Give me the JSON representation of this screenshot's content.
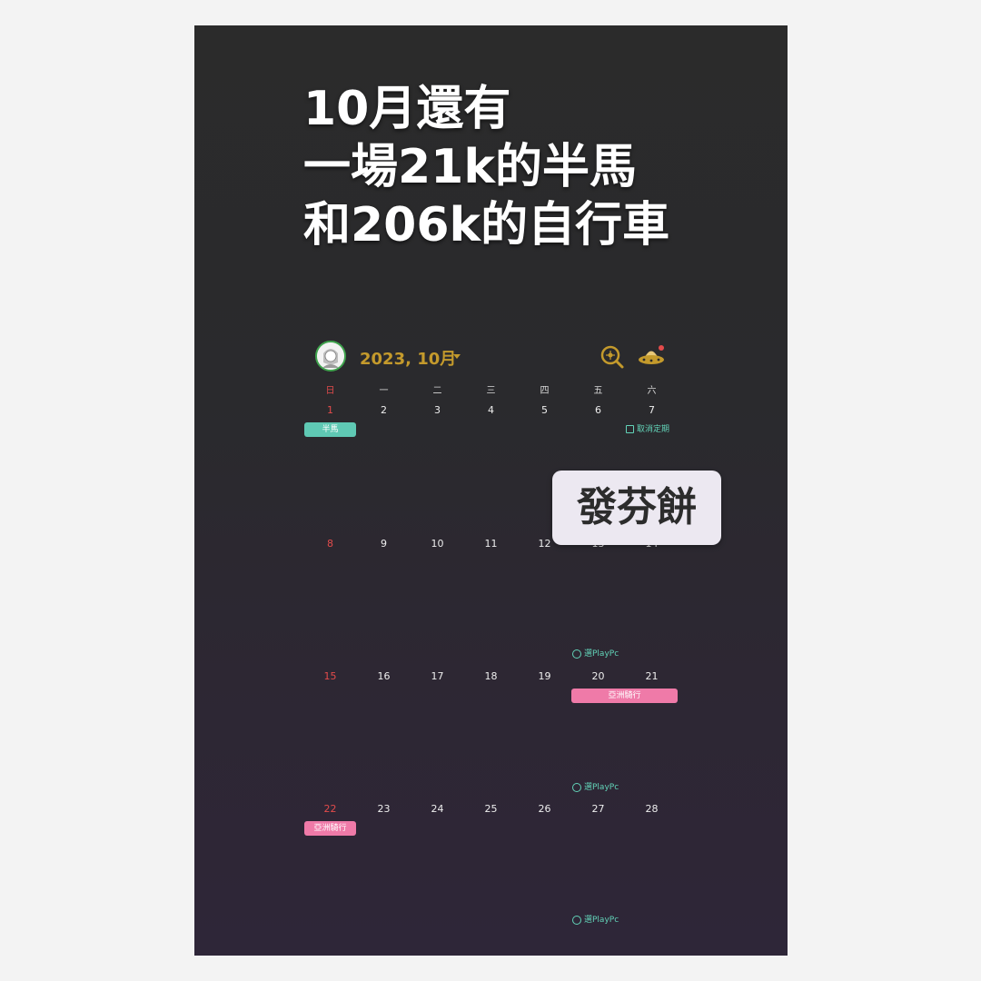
{
  "caption": {
    "lines": [
      "10月還有",
      "一場21k的半馬",
      "和206k的自行車"
    ]
  },
  "calendar": {
    "title": "2023, 10月",
    "accent_color": "#c49a2c",
    "weekdays": [
      "日",
      "一",
      "二",
      "三",
      "四",
      "五",
      "六"
    ],
    "weeks": [
      [
        "1",
        "2",
        "3",
        "4",
        "5",
        "6",
        "7"
      ],
      [
        "8",
        "9",
        "10",
        "11",
        "12",
        "13",
        "14"
      ],
      [
        "15",
        "16",
        "17",
        "18",
        "19",
        "20",
        "21"
      ],
      [
        "22",
        "23",
        "24",
        "25",
        "26",
        "27",
        "28"
      ]
    ],
    "events": {
      "half_marathon": "半馬",
      "cancel_recurring": "取消定期",
      "play_1": "選PlayPc",
      "play_2": "選PlayPc",
      "play_3": "選PlayPc",
      "ride_20": "亞洲騎行",
      "ride_22": "亞洲騎行"
    }
  },
  "sticker": {
    "text": "發芬餅"
  },
  "icons": {
    "avatar": "avatar",
    "search": "search-icon",
    "notifications": "ufo-icon"
  }
}
